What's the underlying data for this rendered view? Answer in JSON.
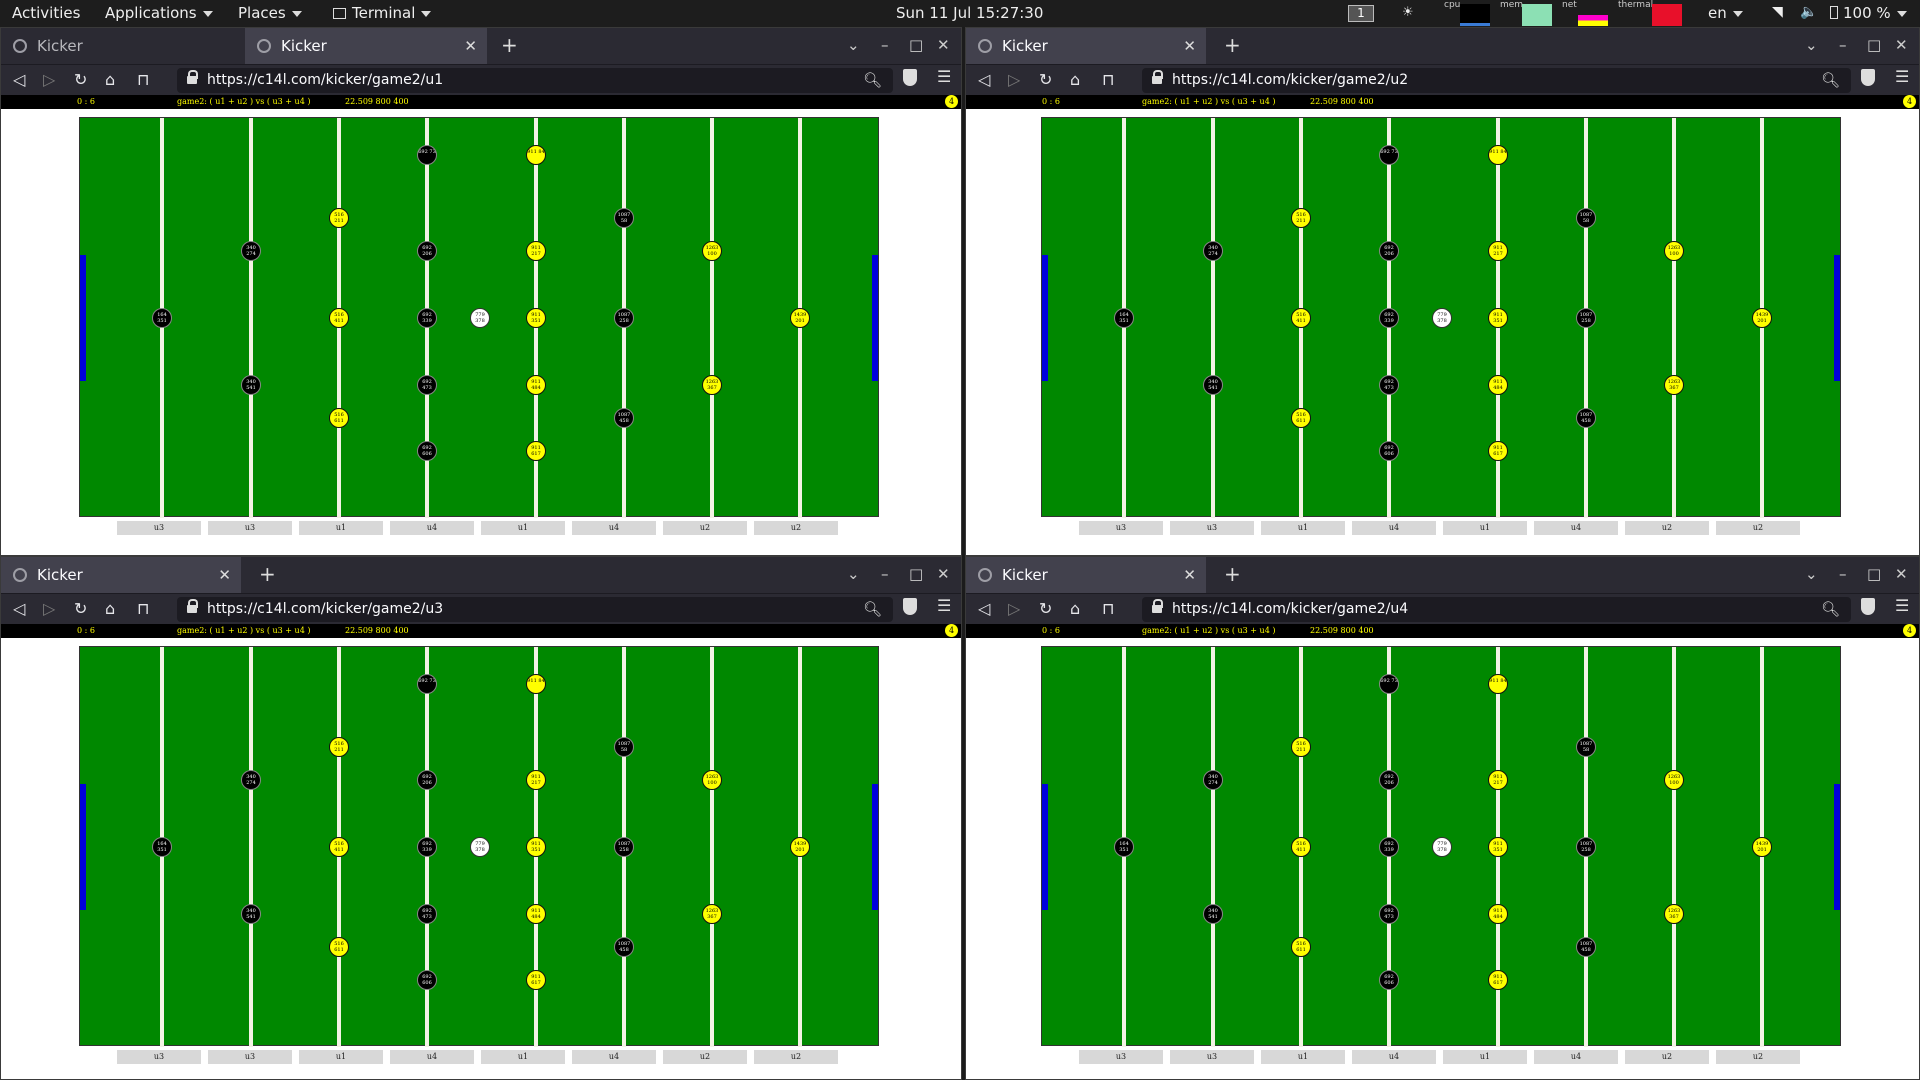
{
  "topbar": {
    "activities": "Activities",
    "applications": "Applications",
    "places": "Places",
    "terminal": "Terminal",
    "datetime": "Sun 11 Jul  15:27:30",
    "workspace": "1",
    "monitors": [
      "cpu",
      "mem",
      "net",
      "thermal"
    ],
    "language": "en",
    "battery": "100 %"
  },
  "browser": {
    "tab_title": "Kicker",
    "new_tab": "+",
    "windows": [
      {
        "url": "https://c14l.com/kicker/game2/u1"
      },
      {
        "url": "https://c14l.com/kicker/game2/u2"
      },
      {
        "url": "https://c14l.com/kicker/game2/u3"
      },
      {
        "url": "https://c14l.com/kicker/game2/u4"
      }
    ]
  },
  "game": {
    "score": "0 : 6",
    "title": "game2: ( u1 + u2 ) vs ( u3 + u4 )",
    "info": "22.509 800 400",
    "indicator": "4",
    "colors": {
      "field": "#008800",
      "goal": "#0000dd",
      "black_team": "#000000",
      "yellow_team": "#ffff00"
    },
    "rods": [
      {
        "label": "u3",
        "team": "black",
        "players": [
          [
            "164",
            "351"
          ]
        ]
      },
      {
        "label": "u3",
        "team": "black",
        "players": [
          [
            "340",
            "274"
          ],
          [
            "340",
            "541"
          ]
        ]
      },
      {
        "label": "u1",
        "team": "yellow",
        "players": [
          [
            "516",
            "211"
          ],
          [
            "516",
            "411"
          ],
          [
            "516",
            "611"
          ]
        ]
      },
      {
        "label": "u4",
        "team": "black",
        "players": [
          [
            "692 73",
            ""
          ],
          [
            "692",
            "206"
          ],
          [
            "692",
            "339"
          ],
          [
            "692",
            "473"
          ],
          [
            "692",
            "606"
          ]
        ]
      },
      {
        "label": "u1",
        "team": "yellow",
        "players": [
          [
            "911 84",
            ""
          ],
          [
            "911",
            "217"
          ],
          [
            "911",
            "351"
          ],
          [
            "911",
            "484"
          ],
          [
            "911",
            "617"
          ]
        ]
      },
      {
        "label": "u4",
        "team": "black",
        "players": [
          [
            "1087",
            "58"
          ],
          [
            "1087",
            "258"
          ],
          [
            "1087",
            "458"
          ]
        ]
      },
      {
        "label": "u2",
        "team": "yellow",
        "players": [
          [
            "1263",
            "100"
          ],
          [
            "1263",
            "367"
          ]
        ]
      },
      {
        "label": "u2",
        "team": "yellow",
        "players": [
          [
            "1439",
            "201"
          ]
        ]
      }
    ],
    "ball": [
      "779",
      "378"
    ]
  }
}
